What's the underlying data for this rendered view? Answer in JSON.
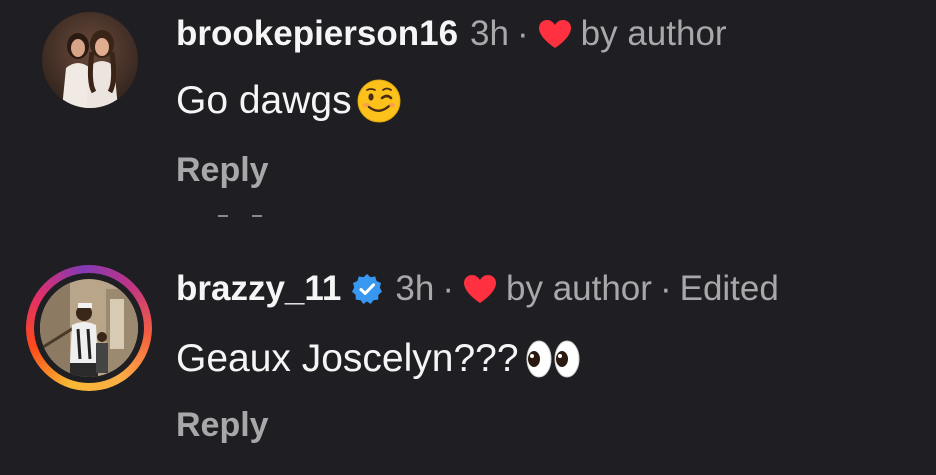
{
  "comments": [
    {
      "username": "brookepierson16",
      "time": "3h",
      "separator": "·",
      "liked_by": "by author",
      "edited": "",
      "verified": false,
      "text": "Go dawgs",
      "emoji": "winking-face",
      "reply_label": "Reply"
    },
    {
      "username": "brazzy_11",
      "time": "3h",
      "separator": "·",
      "liked_by": "by author",
      "edited": "Edited",
      "verified": true,
      "text": "Geaux Joscelyn???",
      "emoji": "eyes",
      "reply_label": "Reply"
    }
  ],
  "colors": {
    "background": "#1f1f23",
    "heart": "#ff3040",
    "verified": "#3897f0",
    "muted_text": "#a8a8ab"
  }
}
